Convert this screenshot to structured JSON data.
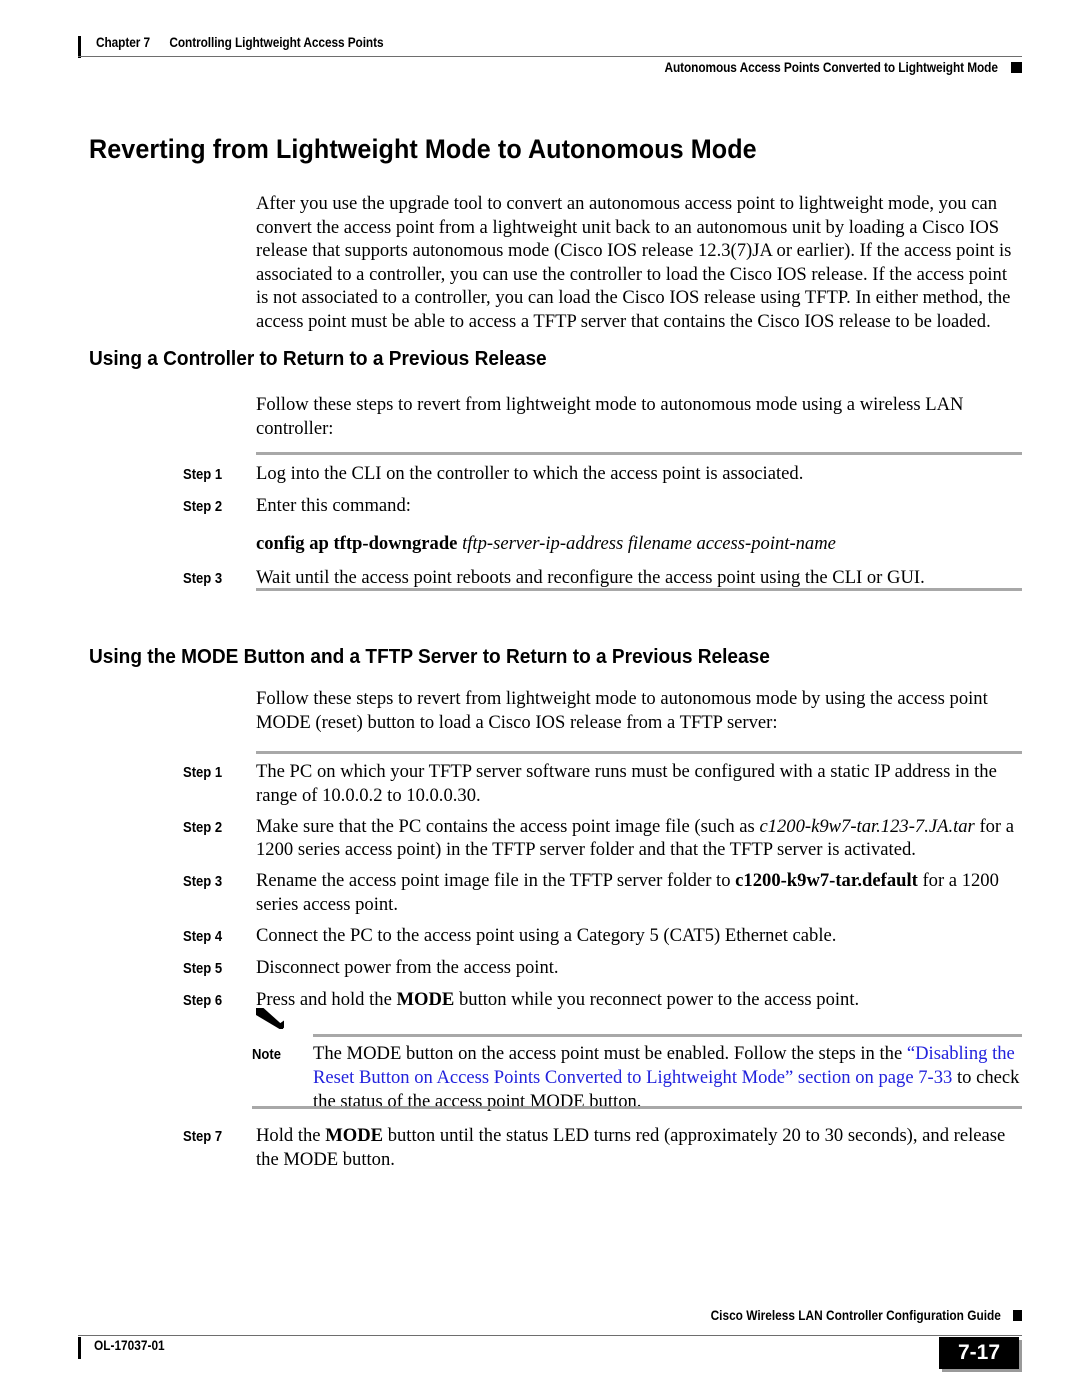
{
  "header": {
    "chapter_number": "Chapter 7",
    "chapter_title": "Controlling Lightweight Access Points",
    "section_running_head": "Autonomous Access Points Converted to Lightweight Mode"
  },
  "main": {
    "title": "Reverting from Lightweight Mode to Autonomous Mode",
    "intro_paragraph": "After you use the upgrade tool to convert an autonomous access point to lightweight mode, you can convert the access point from a lightweight unit back to an autonomous unit by loading a Cisco IOS release that supports autonomous mode (Cisco IOS release 12.3(7)JA or earlier). If the access point is associated to a controller, you can use the controller to load the Cisco IOS release. If the access point is not associated to a controller, you can load the Cisco IOS release using TFTP. In either method, the access point must be able to access a TFTP server that contains the Cisco IOS release to be loaded.",
    "sections": [
      {
        "heading": "Using a Controller to Return to a Previous Release",
        "intro": "Follow these steps to revert from lightweight mode to autonomous mode using a wireless LAN controller:",
        "steps": [
          {
            "label": "Step 1",
            "text": "Log into the CLI on the controller to which the access point is associated."
          },
          {
            "label": "Step 2",
            "text": "Enter this command:",
            "command_bold": "config ap tftp-downgrade",
            "command_italic": "tftp-server-ip-address filename access-point-name"
          },
          {
            "label": "Step 3",
            "text": "Wait until the access point reboots and reconfigure the access point using the CLI or GUI."
          }
        ]
      },
      {
        "heading": "Using the MODE Button and a TFTP Server to Return to a Previous Release",
        "intro": "Follow these steps to revert from lightweight mode to autonomous mode by using the access point MODE (reset) button to load a Cisco IOS release from a TFTP server:",
        "steps_before_note": [
          {
            "label": "Step 1",
            "text_part1": "The PC on which your TFTP server software runs must be configured with a static IP address in the range of 10.0.0.2 to 10.0.0.30."
          },
          {
            "label": "Step 2",
            "text_part1": "Make sure that the PC contains the access point image file (such as ",
            "italic": "c1200-k9w7-tar.123-7.JA.tar",
            "text_part2": " for a 1200 series access point) in the TFTP server folder and that the TFTP server is activated."
          },
          {
            "label": "Step 3",
            "text_part1": "Rename the access point image file in the TFTP server folder to ",
            "bold": "c1200-k9w7-tar.default",
            "text_part2": " for a 1200 series access point."
          },
          {
            "label": "Step 4",
            "text_part1": "Connect the PC to the access point using a Category 5 (CAT5) Ethernet cable."
          },
          {
            "label": "Step 5",
            "text_part1": "Disconnect power from the access point."
          },
          {
            "label": "Step 6",
            "text_part1": "Press and hold the ",
            "bold": "MODE",
            "text_part2": " button while you reconnect power to the access point."
          }
        ],
        "note": {
          "label": "Note",
          "text_part1": "The MODE button on the access point must be enabled. Follow the steps in the ",
          "link": "“Disabling the Reset Button on Access Points Converted to Lightweight Mode” section on page 7-33",
          "text_part2": " to check the status of the access point MODE button."
        },
        "steps_after_note": [
          {
            "label": "Step 7",
            "text_part1": "Hold the ",
            "bold": "MODE",
            "text_part2": " button until the status LED turns red (approximately 20 to 30 seconds), and release the MODE button."
          }
        ]
      }
    ]
  },
  "footer": {
    "guide_title": "Cisco Wireless LAN Controller Configuration Guide",
    "document_id": "OL-17037-01",
    "page_number": "7-17"
  },
  "colors": {
    "link": "#2222dd",
    "rule_gray": "#a8a8a8",
    "thin_rule": "#6e6e6e"
  }
}
